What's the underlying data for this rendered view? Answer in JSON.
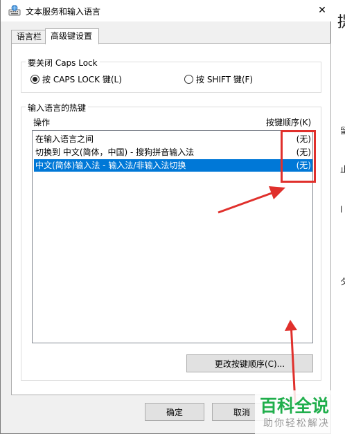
{
  "window": {
    "title": "文本服务和输入语言",
    "close_glyph": "✕"
  },
  "tabs": [
    {
      "label": "语言栏",
      "active": false
    },
    {
      "label": "高级键设置",
      "active": true
    }
  ],
  "caps_lock_group": {
    "legend": "要关闭 Caps Lock",
    "options": [
      {
        "label": "按 CAPS LOCK 键(L)",
        "checked": true
      },
      {
        "label": "按 SHIFT 键(F)",
        "checked": false
      }
    ]
  },
  "hotkeys_group": {
    "legend": "输入语言的热键",
    "col_action": "操作",
    "col_key_sequence": "按键顺序(K)",
    "rows": [
      {
        "action": "在输入语言之间",
        "key": "(无)",
        "selected": false
      },
      {
        "action": "切换到 中文(简体，中国) - 搜狗拼音输入法",
        "key": "(无)",
        "selected": false
      },
      {
        "action": "中文(简体)输入法 - 输入法/非输入法切换",
        "key": "(无)",
        "selected": true
      }
    ],
    "change_button": "更改按键顺序(C)..."
  },
  "footer": {
    "ok_label": "确定",
    "cancel_label": "取消"
  },
  "background_window": {
    "chars": [
      "提",
      "留",
      "止",
      "l",
      "夕"
    ]
  },
  "watermark": {
    "main": "百科全说",
    "sub": "助你轻松解决"
  },
  "colors": {
    "selection": "#0078d7",
    "annotation_red": "#e0302c",
    "watermark_green": "#1fae4b"
  }
}
